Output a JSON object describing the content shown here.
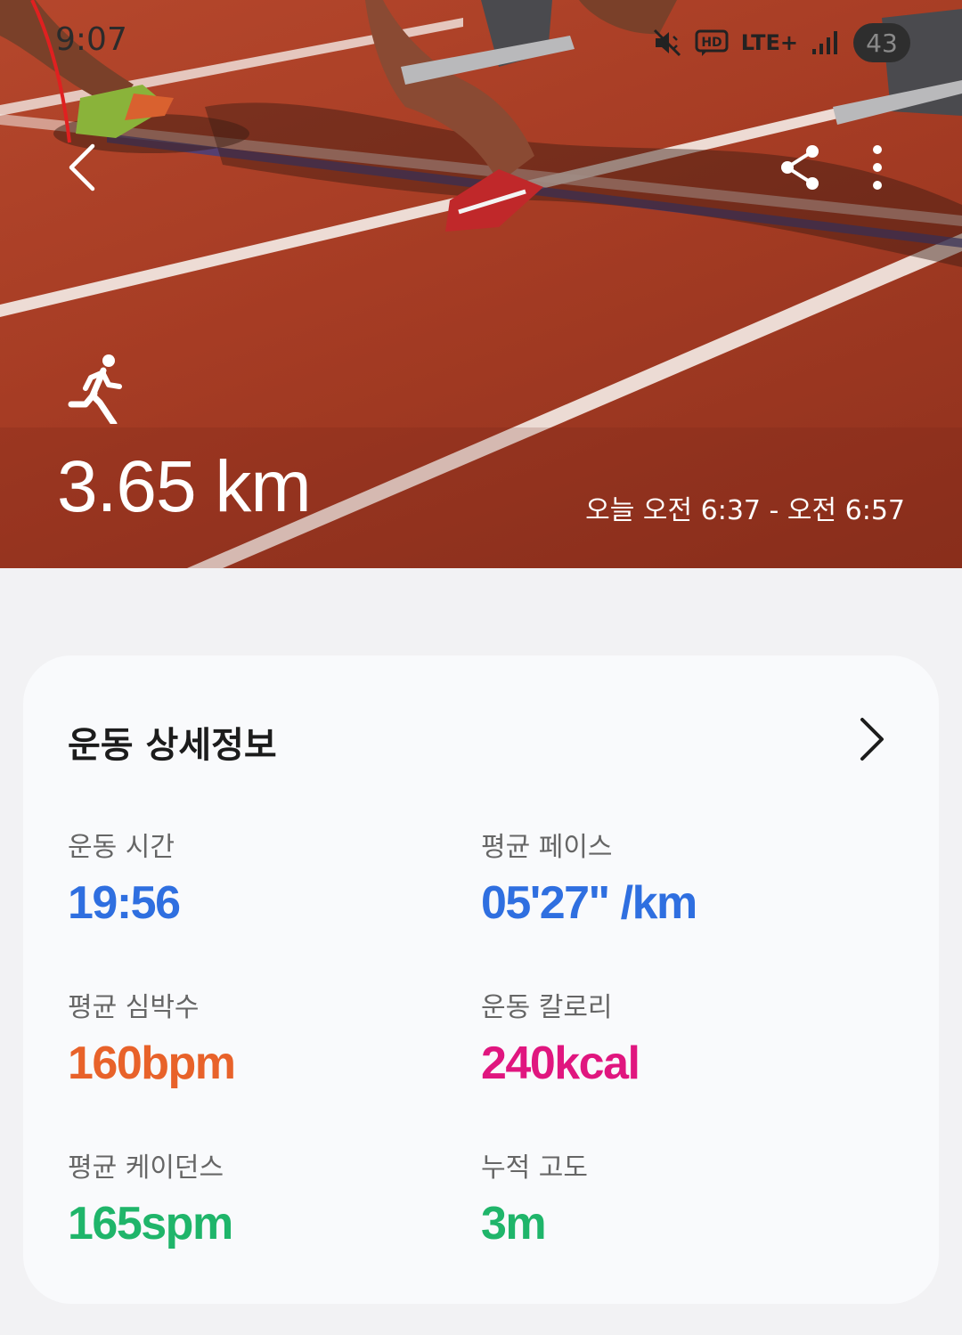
{
  "status_bar": {
    "time": "9:07",
    "network": "LTE+",
    "hd": "HD",
    "battery": "43"
  },
  "hero": {
    "distance": "3.65 km",
    "time_range": "오늘 오전 6:37 - 오전 6:57"
  },
  "details": {
    "title": "운동 상세정보",
    "stats": [
      {
        "label": "운동 시간",
        "value": "19:56",
        "color": "#2f6fe0"
      },
      {
        "label": "평균 페이스",
        "value": "05'27\" /km",
        "color": "#2f6fe0"
      },
      {
        "label": "평균 심박수",
        "value": "160bpm",
        "color": "#e8622a"
      },
      {
        "label": "운동 칼로리",
        "value": "240kcal",
        "color": "#e0167f"
      },
      {
        "label": "평균 케이던스",
        "value": "165spm",
        "color": "#1fb56a"
      },
      {
        "label": "누적 고도",
        "value": "3m",
        "color": "#1fb56a"
      }
    ]
  },
  "icons": {
    "back": "chevron-left-icon",
    "share": "share-icon",
    "more": "more-vertical-icon",
    "activity": "running-icon",
    "detail": "chevron-right-icon"
  }
}
